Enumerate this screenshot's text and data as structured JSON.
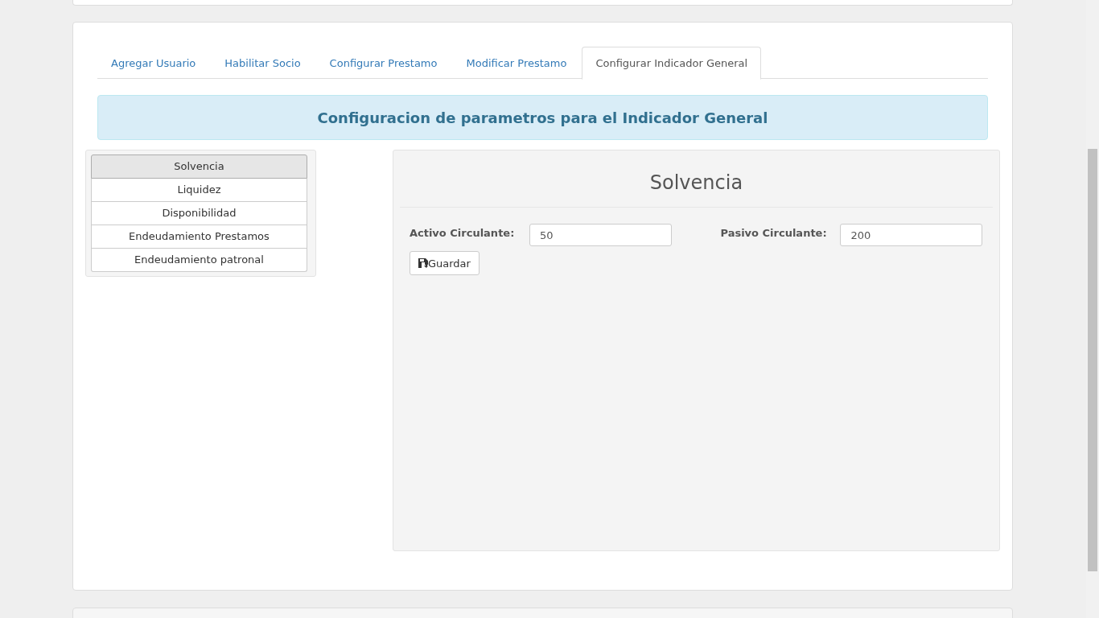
{
  "tabs": [
    {
      "label": "Agregar Usuario",
      "selected": false
    },
    {
      "label": "Habilitar Socio",
      "selected": false
    },
    {
      "label": "Configurar Prestamo",
      "selected": false
    },
    {
      "label": "Modificar Prestamo",
      "selected": false
    },
    {
      "label": "Configurar Indicador General",
      "selected": true
    }
  ],
  "banner": "Configuracion de parametros para el Indicador General",
  "indicators": [
    {
      "label": "Solvencia",
      "selected": true
    },
    {
      "label": "Liquidez",
      "selected": false
    },
    {
      "label": "Disponibilidad",
      "selected": false
    },
    {
      "label": "Endeudamiento Prestamos",
      "selected": false
    },
    {
      "label": "Endeudamiento patronal",
      "selected": false
    }
  ],
  "form": {
    "title": "Solvencia",
    "fields": [
      {
        "label": "Activo Circulante:",
        "value": "50"
      },
      {
        "label": "Pasivo Circulante:",
        "value": "200"
      }
    ],
    "save_button": "Guardar"
  }
}
